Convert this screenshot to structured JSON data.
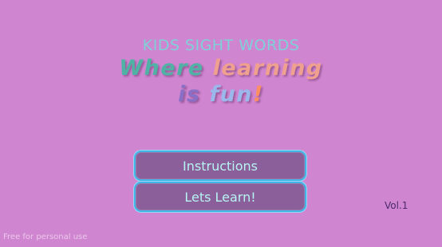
{
  "header": {
    "app_title": "KIDS SIGHT WORDS",
    "tagline_line1": {
      "word1": "Where",
      "word2": "learning"
    },
    "tagline_line2": {
      "word1": "is",
      "word2": "fun",
      "word3": "!"
    }
  },
  "menu": {
    "instructions_label": "Instructions",
    "learn_label": "Lets Learn!"
  },
  "footer": {
    "version": "Vol.1",
    "watermark": "Free for personal use"
  },
  "colors": {
    "background": "#d085d0",
    "button_fill": "#8a5f9a",
    "button_border": "#43b4e8",
    "button_text": "#b7f4f2"
  }
}
